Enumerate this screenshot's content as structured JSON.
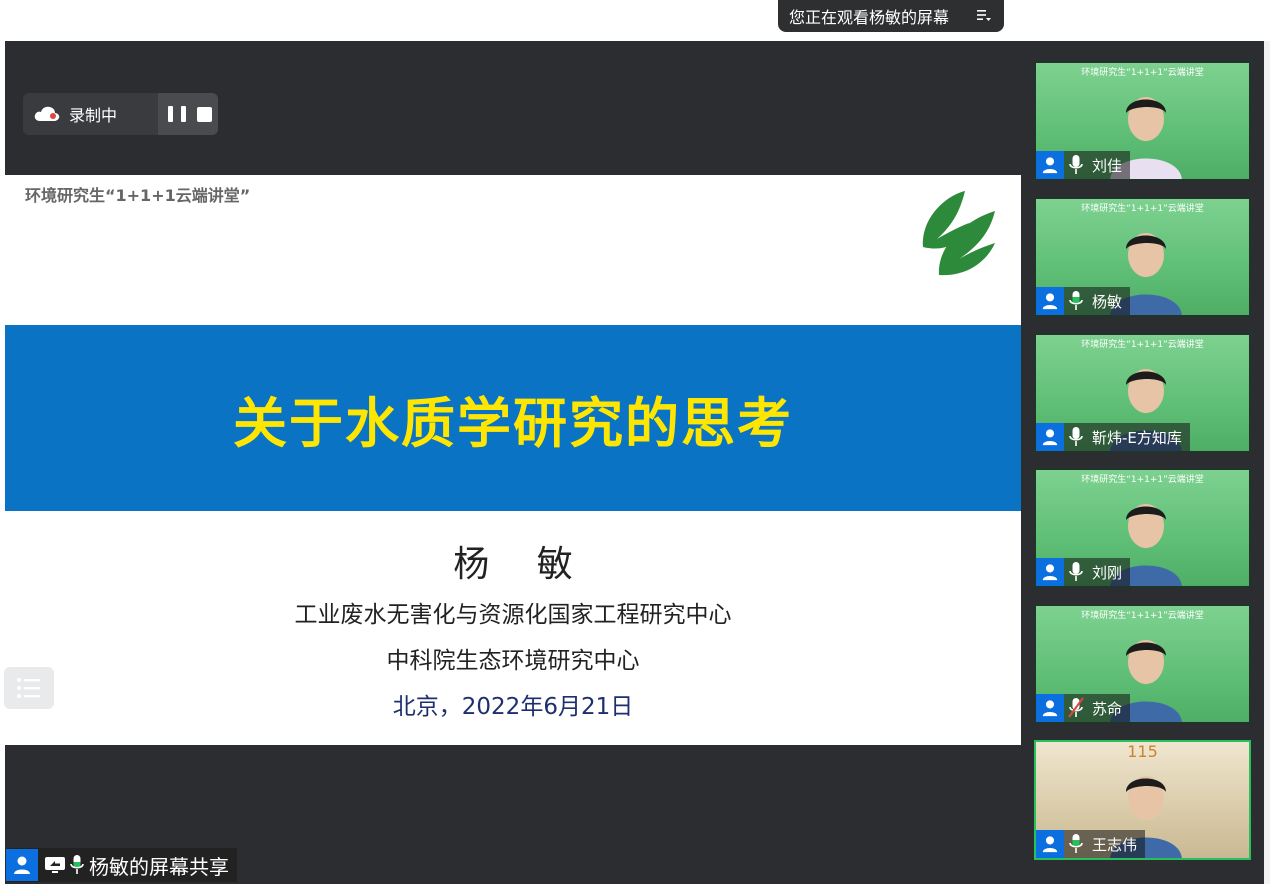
{
  "header": {
    "viewing_text": "您正在观看杨敏的屏幕",
    "menu_icon": "list-settings-icon"
  },
  "recording": {
    "label": "录制中",
    "cloud_icon": "cloud-icon",
    "pause_icon": "pause-icon",
    "stop_icon": "stop-icon"
  },
  "slide": {
    "header_text": "环境研究生“1+1+1云端讲堂”",
    "title": "关于水质学研究的思考",
    "presenter_name": "杨 敏",
    "org_line_1": "工业废水无害化与资源化国家工程研究中心",
    "org_line_2": "中科院生态环境研究中心",
    "date_line": "北京，2022年6月21日",
    "colors": {
      "band": "#0a73c4",
      "title": "#ffe600",
      "date": "#1d2f6e"
    }
  },
  "share": {
    "label": "杨敏的屏幕共享",
    "icons": [
      "user-avatar-icon",
      "screen-share-icon",
      "mic-icon"
    ]
  },
  "participants": [
    {
      "name": "刘佳",
      "banner": "环境研究生“1+1+1”云端讲堂",
      "mic": "on",
      "active": false
    },
    {
      "name": "杨敏",
      "banner": "环境研究生“1+1+1”云端讲堂",
      "mic": "speaking",
      "active": false
    },
    {
      "name": "靳炜-E方知库",
      "banner": "环境研究生“1+1+1”云端讲堂",
      "mic": "on",
      "active": false
    },
    {
      "name": "刘刚",
      "banner": "环境研究生“1+1+1”云端讲堂",
      "mic": "on",
      "active": false
    },
    {
      "name": "苏命",
      "banner": "环境研究生“1+1+1”云端讲堂",
      "mic": "muted",
      "active": false
    },
    {
      "name": "王志伟",
      "banner": "115",
      "mic": "speaking",
      "active": true
    }
  ],
  "accent": "#0b6fdf"
}
